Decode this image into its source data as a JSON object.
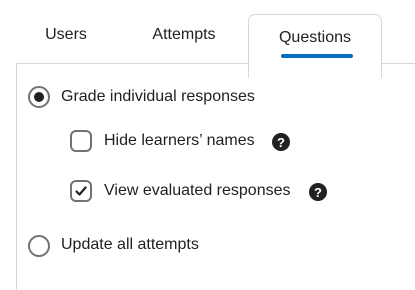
{
  "tabs": [
    {
      "label": "Users",
      "selected": false
    },
    {
      "label": "Attempts",
      "selected": false
    },
    {
      "label": "Questions",
      "selected": true
    }
  ],
  "options": {
    "grade_individual": {
      "label": "Grade individual responses",
      "checked": true
    },
    "hide_names": {
      "label": "Hide learners’ names",
      "checked": false
    },
    "view_evaluated": {
      "label": "View evaluated responses",
      "checked": true
    },
    "update_all": {
      "label": "Update all attempts",
      "checked": false
    }
  },
  "colors": {
    "accent": "#006fbf",
    "border": "#d3d9e3",
    "text": "#202122"
  },
  "icons": {
    "help": "question-circle-icon",
    "check": "checkmark-icon"
  }
}
